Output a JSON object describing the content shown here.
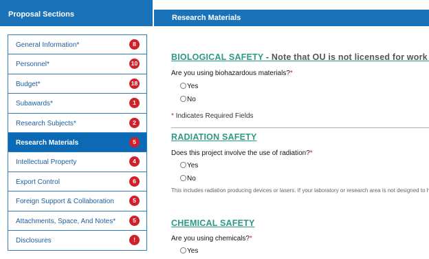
{
  "sidebar": {
    "title": "Proposal Sections",
    "items": [
      {
        "label": "General Information*",
        "badge": "8"
      },
      {
        "label": "Personnel*",
        "badge": "10"
      },
      {
        "label": "Budget*",
        "badge": "18"
      },
      {
        "label": "Subawards*",
        "badge": "1"
      },
      {
        "label": "Research Subjects*",
        "badge": "2"
      },
      {
        "label": "Research Materials",
        "badge": "5"
      },
      {
        "label": "Intellectual Property",
        "badge": "4"
      },
      {
        "label": "Export Control",
        "badge": "6"
      },
      {
        "label": "Foreign Support & Collaboration",
        "badge": "5"
      },
      {
        "label": "Attachments, Space, And Notes*",
        "badge": "5"
      },
      {
        "label": "Disclosures",
        "badge": "!"
      }
    ]
  },
  "main": {
    "title": "Research Materials",
    "biological": {
      "title": "BIOLOGICAL SAFETY",
      "note": " - Note that OU is not licensed for work with sele",
      "question": "Are you using biohazardous materials?",
      "yes": "Yes",
      "no": "No"
    },
    "required_asterisk": "*",
    "required_note": "Indicates Required Fields",
    "radiation": {
      "title": "RADIATION SAFETY",
      "question": "Does this project involve the use of radiation?",
      "yes": "Yes",
      "no": "No",
      "help": "This includes radiation producing devices or lasers. If your laboratory or research area is not designed to ha"
    },
    "chemical": {
      "title": "CHEMICAL SAFETY",
      "question": "Are you using chemicals?",
      "yes": "Yes"
    }
  },
  "colors": {
    "header_blue": "#1a73b8",
    "active_blue": "#0b69b6",
    "badge_red": "#d0202a",
    "section_green": "#2a9a86"
  }
}
